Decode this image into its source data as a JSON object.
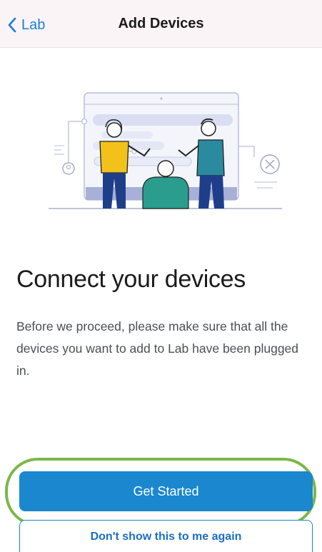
{
  "navbar": {
    "back_label": "Lab",
    "title": "Add Devices"
  },
  "icons": {
    "back": "chevron-left-icon",
    "illustration": "people-connecting-devices-illustration"
  },
  "content": {
    "heading": "Connect your devices",
    "body": "Before we proceed, please make sure that all the devices you want to add to Lab have been plugged in."
  },
  "actions": {
    "primary_label": "Get Started",
    "secondary_label": "Don't show this to me again"
  },
  "colors": {
    "accent": "#1a87cf",
    "back_link": "#1a7fd4",
    "focus_ring": "#7ab848",
    "navbar_bg": "#fbf4f7"
  }
}
